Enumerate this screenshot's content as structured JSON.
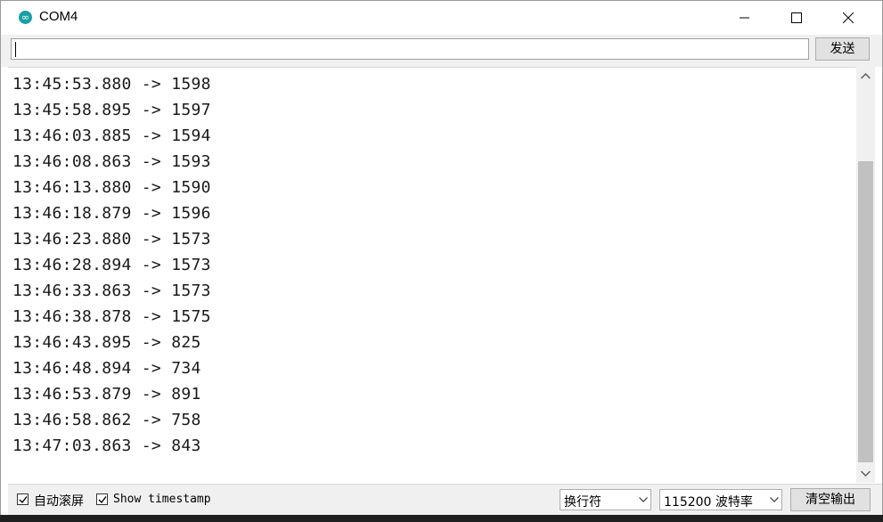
{
  "window": {
    "title": "COM4",
    "app_icon": "arduino-icon"
  },
  "send": {
    "input_value": "",
    "button_label": "发送"
  },
  "output": {
    "lines": [
      "13:45:53.880 -> 1598",
      "13:45:58.895 -> 1597",
      "13:46:03.885 -> 1594",
      "13:46:08.863 -> 1593",
      "13:46:13.880 -> 1590",
      "13:46:18.879 -> 1596",
      "13:46:23.880 -> 1573",
      "13:46:28.894 -> 1573",
      "13:46:33.863 -> 1573",
      "13:46:38.878 -> 1575",
      "13:46:43.895 -> 825",
      "13:46:48.894 -> 734",
      "13:46:53.879 -> 891",
      "13:46:58.862 -> 758",
      "13:47:03.863 -> 843"
    ]
  },
  "bottom": {
    "autoscroll": {
      "label": "自动滚屏",
      "checked": true
    },
    "timestamp": {
      "label": "Show timestamp",
      "checked": true
    },
    "line_ending": "换行符",
    "baud_rate": "115200 波特率",
    "clear_label": "清空输出"
  },
  "colors": {
    "app_icon": "#17a1a5",
    "panel": "#f0f0f0",
    "button": "#e1e1e1",
    "scroll_thumb": "#c1c1c1"
  }
}
